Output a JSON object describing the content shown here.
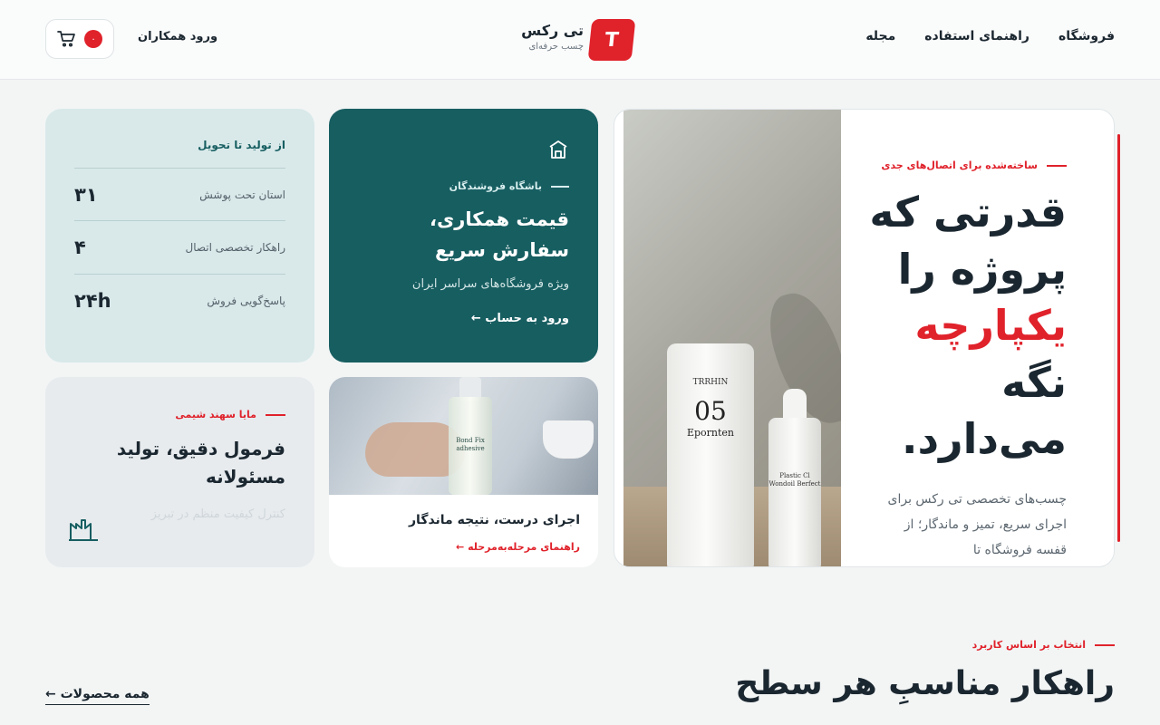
{
  "header": {
    "nav": [
      "فروشگاه",
      "راهنمای استفاده",
      "مجله"
    ],
    "logo_letter": "T",
    "brand_name": "تی رکس",
    "brand_tagline": "چسب حرفه‌ای",
    "partner_login": "ورود همکاران",
    "cart_count": "۰",
    "icons": {
      "cart": "cart-icon"
    }
  },
  "hero": {
    "eyebrow": "ساخته‌شده برای اتصال‌های جدی",
    "title_line1": "قدرتی که",
    "title_line2": "پروژه را",
    "title_highlight": "یکپارچه",
    "title_line4": "نگه",
    "title_line5": "می‌دارد.",
    "description": "چسب‌های تخصصی تی رکس برای اجرای سریع، تمیز و ماندگار؛ از قفسه فروشگاه تا",
    "image_tube_brand": "TRRHIN",
    "image_tube_number": "05",
    "image_tube_sub": "Epornten",
    "image_bottle_text": "Plastic Cl Wondoil Berfect",
    "accent_color": "#e0222b"
  },
  "retailer_card": {
    "eyebrow": "باشگاه فروشندگان",
    "title": "قیمت همکاری، سفارش سریع",
    "description": "ویژه فروشگاه‌های سراسر ایران",
    "link": "ورود به حساب ←",
    "icon": "store-icon",
    "bg_color": "#175e61"
  },
  "stats_card": {
    "title": "از تولید تا تحویل",
    "items": [
      {
        "value": "۳۱",
        "label": "استان تحت پوشش"
      },
      {
        "value": "۴",
        "label": "راهکار تخصصی اتصال"
      },
      {
        "value": "۲۴h",
        "label": "پاسخ‌گویی فروش"
      }
    ]
  },
  "guide_card": {
    "title": "اجرای درست، نتیجه ماندگار",
    "link": "راهنمای مرحله‌به‌مرحله ←",
    "image_label": "Bond Fix adhesive"
  },
  "chemical_card": {
    "eyebrow": "مایا سهند شیمی",
    "title": "فرمول دقیق، تولید مسئولانه",
    "description": "کنترل کیفیت منظم در تبریز",
    "icon": "factory-icon"
  },
  "products_section": {
    "eyebrow": "انتخاب بر اساس کاربرد",
    "title": "راهکار مناسبِ هر سطح",
    "all_products": "همه محصولات ←"
  }
}
